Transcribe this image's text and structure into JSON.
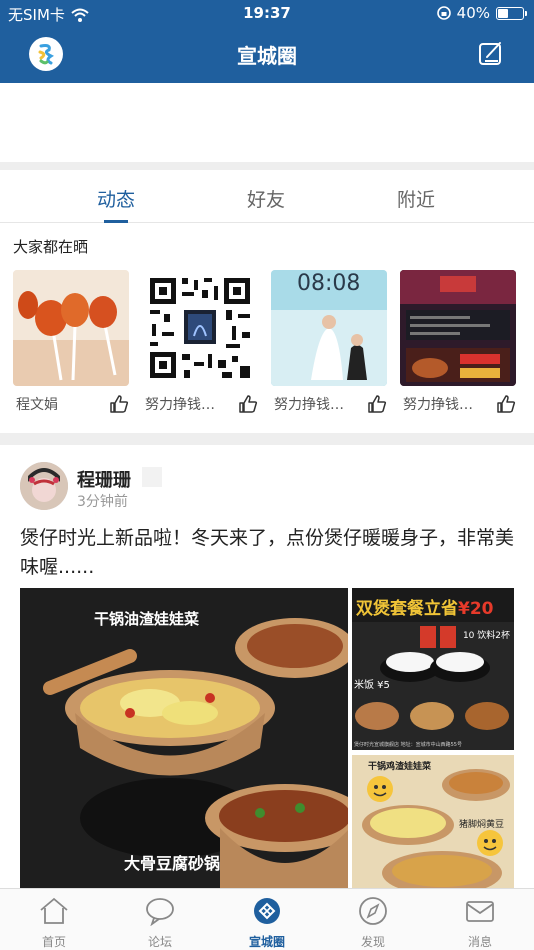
{
  "status_bar": {
    "carrier": "无SIM卡",
    "time": "19:37",
    "battery": "40%",
    "battery_level": 0.4
  },
  "nav": {
    "title": "宣城圈",
    "logo_icon": "app-logo-icon",
    "edit_icon": "edit-icon"
  },
  "tabs": [
    {
      "label": "动态",
      "active": true
    },
    {
      "label": "好友",
      "active": false
    },
    {
      "label": "附近",
      "active": false
    }
  ],
  "stories": {
    "title": "大家都在晒",
    "items": [
      {
        "name": "程文娟",
        "image": "candy-lollipops"
      },
      {
        "name": "努力挣钱…",
        "image": "qr-code"
      },
      {
        "name": "努力挣钱…",
        "image": "wedding-photo"
      },
      {
        "name": "努力挣钱…",
        "image": "promo-poster"
      }
    ]
  },
  "post": {
    "author": "程珊珊",
    "time": "3分钟前",
    "text": "煲仔时光上新品啦！冬天来了，点份煲仔暖暖身子，非常美味喔......",
    "images": {
      "main": {
        "caption_top": "干锅油渣娃娃菜",
        "caption_bottom": "大骨豆腐砂锅"
      },
      "side1": {
        "title": "双煲套餐立省",
        "price": "¥20",
        "sub": "米饭 ¥5",
        "drink": "10 饮料2杯",
        "footer": "煲仔时光宣城旗舰店 地址：宣城市中山西路55号"
      },
      "side2": {
        "caption_top": "干锅鸡渣娃娃菜",
        "caption_side": "猪脚焖黄豆"
      }
    }
  },
  "tabbar": [
    {
      "label": "首页",
      "icon": "home-icon",
      "active": false
    },
    {
      "label": "论坛",
      "icon": "chat-icon",
      "active": false
    },
    {
      "label": "宣城圈",
      "icon": "circle-icon",
      "active": true
    },
    {
      "label": "发现",
      "icon": "compass-icon",
      "active": false
    },
    {
      "label": "消息",
      "icon": "mail-icon",
      "active": false
    }
  ],
  "colors": {
    "brand": "#1f5f9e",
    "divider": "#eeeeee"
  }
}
